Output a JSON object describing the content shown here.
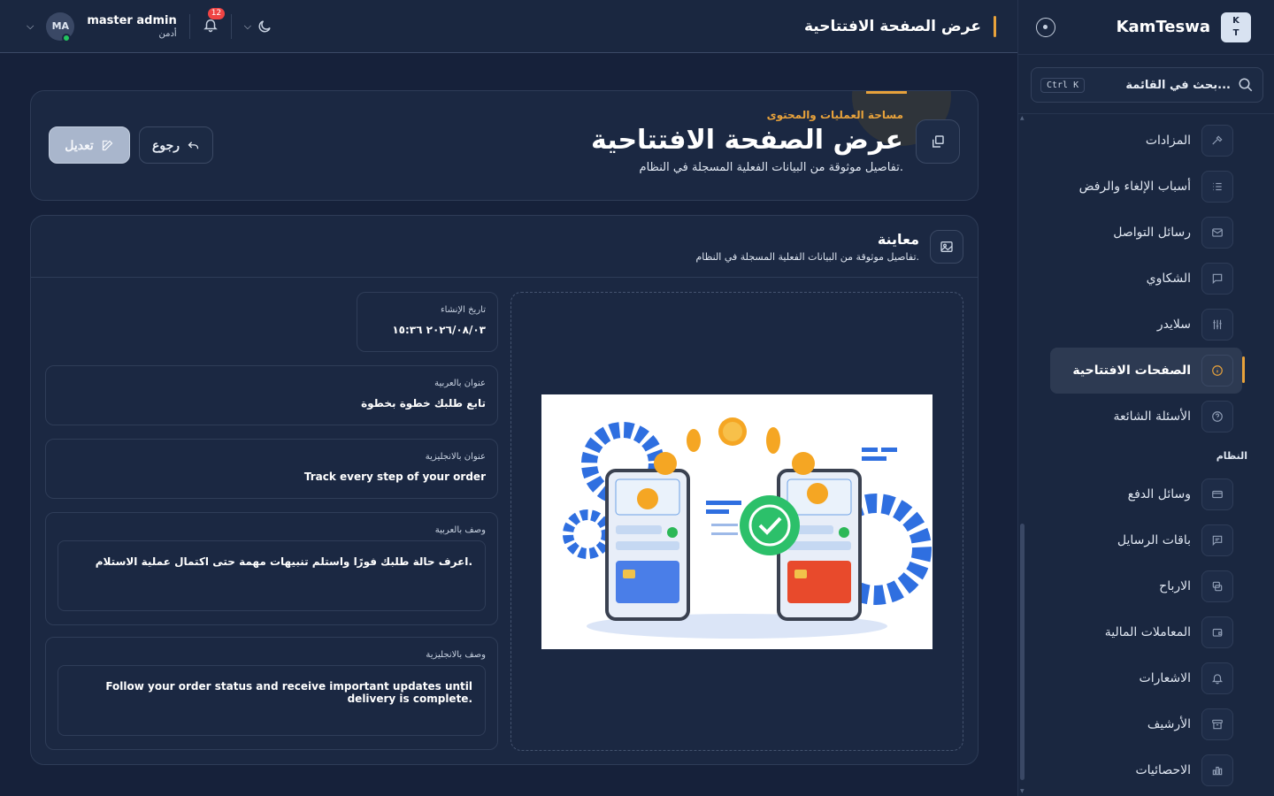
{
  "sidebar": {
    "brand_logo": [
      "K",
      "T"
    ],
    "brand_name": "KamTeswa",
    "search_placeholder": "بحث في القائمة...",
    "search_shortcut": "Ctrl K",
    "items": [
      {
        "label": "المزادات",
        "icon": "hammer-icon"
      },
      {
        "label": "أسباب الإلغاء والرفض",
        "icon": "list-icon"
      },
      {
        "label": "رسائل التواصل",
        "icon": "mail-icon"
      },
      {
        "label": "الشكاوي",
        "icon": "chat-icon"
      },
      {
        "label": "سلايدر",
        "icon": "sliders-icon"
      },
      {
        "label": "الصفحات الافتتاحية",
        "icon": "info-icon",
        "active": true
      },
      {
        "label": "الأسئلة الشائعة",
        "icon": "help-icon"
      }
    ],
    "section_system": "النظام",
    "system_items": [
      {
        "label": "وسائل الدفع",
        "icon": "card-icon"
      },
      {
        "label": "باقات الرسايل",
        "icon": "message-icon"
      },
      {
        "label": "الارباح",
        "icon": "coins-icon"
      },
      {
        "label": "المعاملات المالية",
        "icon": "wallet-icon"
      },
      {
        "label": "الاشعارات",
        "icon": "bell-icon"
      },
      {
        "label": "الأرشيف",
        "icon": "archive-icon"
      },
      {
        "label": "الاحصائيات",
        "icon": "chart-icon"
      }
    ]
  },
  "topbar": {
    "title": "عرض الصفحة الافتتاحية",
    "user_name": "master admin",
    "user_role": "أدمن",
    "avatar_initials": "MA",
    "notification_count": "12"
  },
  "header": {
    "eyebrow": "مساحة العمليات والمحتوى",
    "title": "عرض الصفحة الافتتاحية",
    "subtitle": "تفاصيل موثوقة من البيانات الفعلية المسجلة في النظام.",
    "edit_label": "تعديل",
    "back_label": "رجوع"
  },
  "preview": {
    "title": "معاينة",
    "subtitle": "تفاصيل موثوقة من البيانات الفعلية المسجلة في النظام."
  },
  "fields": {
    "created_label": "تاريخ الإنشاء",
    "created_value": "٢٠٢٦/٠٨/٠٣ ١٥:٣٦",
    "title_ar_label": "عنوان بالعربية",
    "title_ar_value": "تابع طلبك خطوة بخطوة",
    "title_en_label": "عنوان بالانجليزية",
    "title_en_value": "Track every step of your order",
    "desc_ar_label": "وصف بالعربية",
    "desc_ar_value": "اعرف حالة طلبك فورًا واستلم تنبيهات مهمة حتى اكتمال عملية الاستلام.",
    "desc_en_label": "وصف بالانجليزية",
    "desc_en_value": "Follow your order status and receive important updates until delivery is complete."
  },
  "colors": {
    "accent": "#e8a23b",
    "background": "#16213a",
    "card": "#1b2842",
    "online": "#22c55e",
    "badge": "#ef4444"
  }
}
